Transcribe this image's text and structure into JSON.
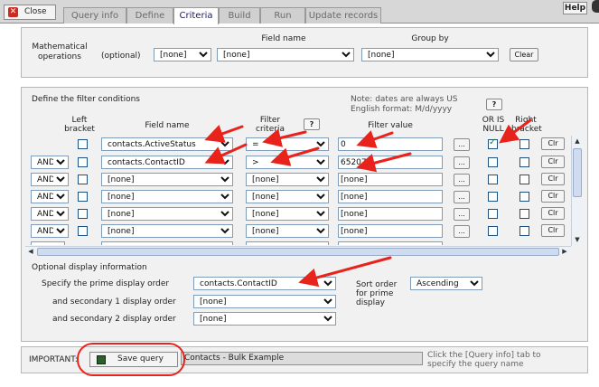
{
  "topbar": {
    "close_label": "Close",
    "tabs": [
      {
        "label": "Query info",
        "active": false
      },
      {
        "label": "Define",
        "active": false
      },
      {
        "label": "Criteria",
        "active": true
      },
      {
        "label": "Build",
        "active": false
      },
      {
        "label": "Run",
        "active": false
      },
      {
        "label": "Update records",
        "active": false
      }
    ],
    "help_label": "Help"
  },
  "math": {
    "title_line1": "Mathematical",
    "title_line2": "operations",
    "optional_label": "(optional)",
    "field_name_header": "Field name",
    "group_by_header": "Group by",
    "operation_value": "[none]",
    "field_value": "[none]",
    "group_value": "[none]",
    "clear_label": "Clear"
  },
  "filter": {
    "title": "Define the filter conditions",
    "note_line1": "Note: dates are always US",
    "note_line2": "English format: M/d/yyyy",
    "headers": {
      "left_bracket_1": "Left",
      "left_bracket_2": "bracket",
      "field_name": "Field name",
      "filter_criteria_1": "Filter",
      "filter_criteria_2": "criteria",
      "filter_value": "Filter value",
      "or_is_null_1": "OR IS",
      "or_is_null_2": "NULL",
      "right_bracket_1": "Right",
      "right_bracket_2": "bracket"
    },
    "help_label": "?",
    "ellipsis_label": "...",
    "clr_label": "Clr",
    "rows": [
      {
        "join": "",
        "left_bracket": false,
        "field": "contacts.ActiveStatus",
        "criteria": "=",
        "value": "0",
        "or_null": true,
        "right_bracket": false
      },
      {
        "join": "AND",
        "left_bracket": false,
        "field": "contacts.ContactID",
        "criteria": ">",
        "value": "65207",
        "or_null": false,
        "right_bracket": false
      },
      {
        "join": "AND",
        "left_bracket": false,
        "field": "[none]",
        "criteria": "[none]",
        "value": "[none]",
        "or_null": false,
        "right_bracket": false
      },
      {
        "join": "AND",
        "left_bracket": false,
        "field": "[none]",
        "criteria": "[none]",
        "value": "[none]",
        "or_null": false,
        "right_bracket": false
      },
      {
        "join": "AND",
        "left_bracket": false,
        "field": "[none]",
        "criteria": "[none]",
        "value": "[none]",
        "or_null": false,
        "right_bracket": false
      },
      {
        "join": "AND",
        "left_bracket": false,
        "field": "[none]",
        "criteria": "[none]",
        "value": "[none]",
        "or_null": false,
        "right_bracket": false
      }
    ]
  },
  "display": {
    "title": "Optional display information",
    "prime_label": "Specify the prime display order",
    "prime_value": "contacts.ContactID",
    "secondary1_label": "and secondary 1 display order",
    "secondary1_value": "[none]",
    "secondary2_label": "and secondary 2 display order",
    "secondary2_value": "[none]",
    "sort_label_1": "Sort order",
    "sort_label_2": "for prime",
    "sort_label_3": "display",
    "sort_value": "Ascending"
  },
  "save": {
    "important_label": "IMPORTANT:",
    "save_label": "Save query",
    "query_name": "Contacts - Bulk Example",
    "hint_line1": "Click the [Query info] tab to",
    "hint_line2": "specify the query name"
  },
  "colors": {
    "annotation": "#e8231b",
    "panel": "#f1f1f1",
    "active_tab_text": "#1a1a6a"
  }
}
